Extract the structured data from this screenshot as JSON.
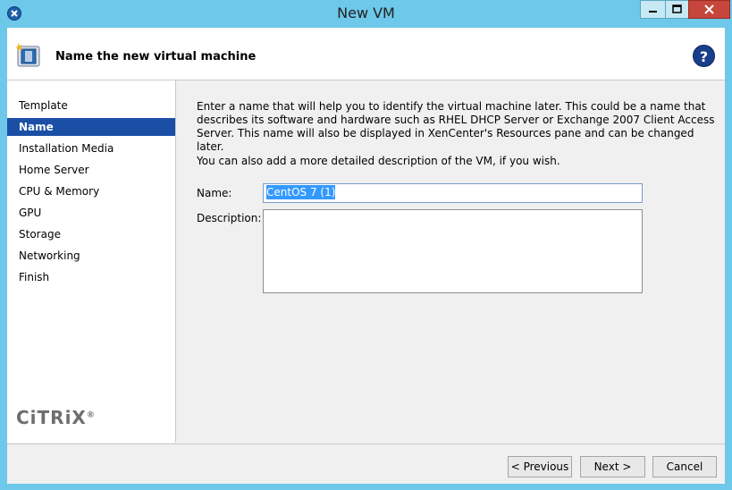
{
  "window": {
    "title": "New VM",
    "icon": "xencenter-app-icon"
  },
  "header": {
    "title": "Name the new virtual machine",
    "help_icon": "?"
  },
  "steps": [
    {
      "label": "Template",
      "active": false
    },
    {
      "label": "Name",
      "active": true
    },
    {
      "label": "Installation Media",
      "active": false
    },
    {
      "label": "Home Server",
      "active": false
    },
    {
      "label": "CPU & Memory",
      "active": false
    },
    {
      "label": "GPU",
      "active": false
    },
    {
      "label": "Storage",
      "active": false
    },
    {
      "label": "Networking",
      "active": false
    },
    {
      "label": "Finish",
      "active": false
    }
  ],
  "brand": {
    "logo_text": "CiTRiX",
    "trademark": "®"
  },
  "main": {
    "intro": "Enter a name that will help you to identify the virtual machine later. This could be a name that describes its software and hardware such as RHEL DHCP Server or Exchange 2007 Client Access Server. This name will also be displayed in XenCenter's Resources pane and can be changed later.",
    "intro2": "You can also add a more detailed description of the VM, if you wish.",
    "name_label": "Name:",
    "name_value": "CentOS 7 (1)",
    "description_label": "Description:",
    "description_value": ""
  },
  "footer": {
    "previous_label": "< Previous",
    "next_label": "Next >",
    "cancel_label": "Cancel"
  },
  "colors": {
    "titlebar": "#6dc8ea",
    "selected_step": "#1b4fa5",
    "close_button": "#c7463b"
  }
}
